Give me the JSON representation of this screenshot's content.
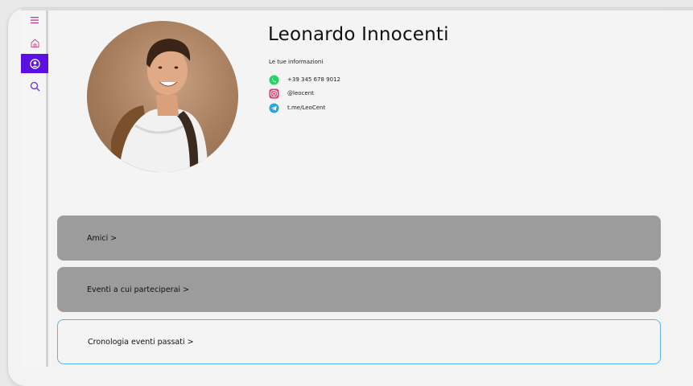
{
  "profile": {
    "name": "Leonardo Innocenti",
    "info_title": "Le tue informazioni",
    "contacts": [
      {
        "icon": "whatsapp-icon",
        "text": "+39 345 678 9012",
        "color": "#25d366"
      },
      {
        "icon": "instagram-icon",
        "text": "@leocent",
        "color": "#e1306c"
      },
      {
        "icon": "telegram-icon",
        "text": "t.me/LeoCent",
        "color": "#2aa3e0"
      }
    ]
  },
  "sidebar": {
    "items": [
      {
        "icon": "menu-icon",
        "active": false
      },
      {
        "icon": "home-icon",
        "active": false
      },
      {
        "icon": "user-icon",
        "active": true
      },
      {
        "icon": "search-icon",
        "active": false
      }
    ],
    "accent_color": "#5b0fe0"
  },
  "sections": [
    {
      "label": "Amici >"
    },
    {
      "label": "Eventi a cui parteciperai >"
    },
    {
      "label": "Cronologia eventi passati >"
    }
  ]
}
